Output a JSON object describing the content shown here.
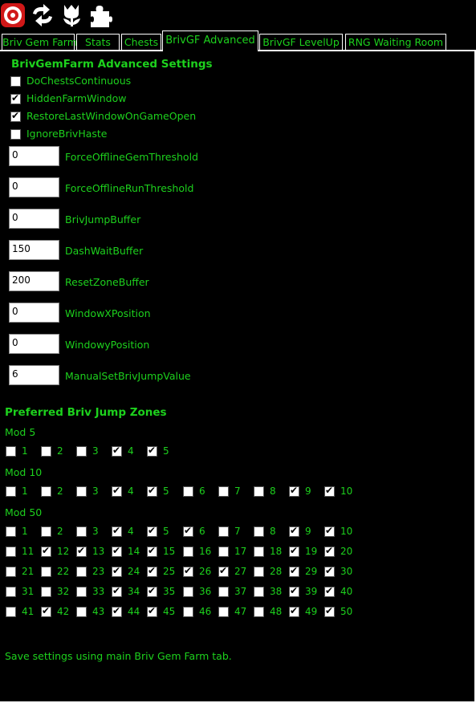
{
  "toolbar": {
    "icons": [
      "record-icon",
      "refresh-icon",
      "tulip-icon",
      "puzzle-icon"
    ]
  },
  "tabs": [
    {
      "label": "Briv Gem Farm",
      "active": false
    },
    {
      "label": "Stats",
      "active": false
    },
    {
      "label": "Chests",
      "active": false
    },
    {
      "label": "BrivGF Advanced",
      "active": true
    },
    {
      "label": "BrivGF LevelUp",
      "active": false
    },
    {
      "label": "RNG Waiting Room",
      "active": false
    }
  ],
  "advanced": {
    "title": "BrivGemFarm Advanced Settings",
    "checkboxes": [
      {
        "label": "DoChestsContinuous",
        "checked": false
      },
      {
        "label": "HiddenFarmWindow",
        "checked": true
      },
      {
        "label": "RestoreLastWindowOnGameOpen",
        "checked": true
      },
      {
        "label": "IgnoreBrivHaste",
        "checked": false
      }
    ],
    "fields": [
      {
        "label": "ForceOfflineGemThreshold",
        "value": "0"
      },
      {
        "label": "ForceOfflineRunThreshold",
        "value": "0"
      },
      {
        "label": "BrivJumpBuffer",
        "value": "0"
      },
      {
        "label": "DashWaitBuffer",
        "value": "150"
      },
      {
        "label": "ResetZoneBuffer",
        "value": "200"
      },
      {
        "label": "WindowXPosition",
        "value": "0"
      },
      {
        "label": "WindowyPosition",
        "value": "0"
      },
      {
        "label": "ManualSetBrivJumpValue",
        "value": "6"
      }
    ]
  },
  "jump_zones": {
    "title": "Preferred Briv Jump Zones",
    "mods": [
      {
        "label": "Mod 5",
        "zones": [
          {
            "n": "1",
            "checked": false
          },
          {
            "n": "2",
            "checked": false
          },
          {
            "n": "3",
            "checked": false
          },
          {
            "n": "4",
            "checked": true
          },
          {
            "n": "5",
            "checked": true
          }
        ]
      },
      {
        "label": "Mod 10",
        "zones": [
          {
            "n": "1",
            "checked": false
          },
          {
            "n": "2",
            "checked": false
          },
          {
            "n": "3",
            "checked": false
          },
          {
            "n": "4",
            "checked": true
          },
          {
            "n": "5",
            "checked": true
          },
          {
            "n": "6",
            "checked": false
          },
          {
            "n": "7",
            "checked": false
          },
          {
            "n": "8",
            "checked": false
          },
          {
            "n": "9",
            "checked": true
          },
          {
            "n": "10",
            "checked": true
          }
        ]
      },
      {
        "label": "Mod 50",
        "zones": [
          {
            "n": "1",
            "checked": false
          },
          {
            "n": "2",
            "checked": false
          },
          {
            "n": "3",
            "checked": false
          },
          {
            "n": "4",
            "checked": true
          },
          {
            "n": "5",
            "checked": true
          },
          {
            "n": "6",
            "checked": true
          },
          {
            "n": "7",
            "checked": false
          },
          {
            "n": "8",
            "checked": false
          },
          {
            "n": "9",
            "checked": true
          },
          {
            "n": "10",
            "checked": true
          },
          {
            "n": "11",
            "checked": false
          },
          {
            "n": "12",
            "checked": true
          },
          {
            "n": "13",
            "checked": true
          },
          {
            "n": "14",
            "checked": true
          },
          {
            "n": "15",
            "checked": true
          },
          {
            "n": "16",
            "checked": false
          },
          {
            "n": "17",
            "checked": false
          },
          {
            "n": "18",
            "checked": false
          },
          {
            "n": "19",
            "checked": true
          },
          {
            "n": "20",
            "checked": true
          },
          {
            "n": "21",
            "checked": false
          },
          {
            "n": "22",
            "checked": false
          },
          {
            "n": "23",
            "checked": false
          },
          {
            "n": "24",
            "checked": true
          },
          {
            "n": "25",
            "checked": true
          },
          {
            "n": "26",
            "checked": true
          },
          {
            "n": "27",
            "checked": true
          },
          {
            "n": "28",
            "checked": false
          },
          {
            "n": "29",
            "checked": true
          },
          {
            "n": "30",
            "checked": true
          },
          {
            "n": "31",
            "checked": false
          },
          {
            "n": "32",
            "checked": false
          },
          {
            "n": "33",
            "checked": false
          },
          {
            "n": "34",
            "checked": true
          },
          {
            "n": "35",
            "checked": true
          },
          {
            "n": "36",
            "checked": false
          },
          {
            "n": "37",
            "checked": false
          },
          {
            "n": "38",
            "checked": false
          },
          {
            "n": "39",
            "checked": true
          },
          {
            "n": "40",
            "checked": true
          },
          {
            "n": "41",
            "checked": false
          },
          {
            "n": "42",
            "checked": true
          },
          {
            "n": "43",
            "checked": false
          },
          {
            "n": "44",
            "checked": true
          },
          {
            "n": "45",
            "checked": true
          },
          {
            "n": "46",
            "checked": false
          },
          {
            "n": "47",
            "checked": false
          },
          {
            "n": "48",
            "checked": false
          },
          {
            "n": "49",
            "checked": true
          },
          {
            "n": "50",
            "checked": true
          }
        ]
      }
    ]
  },
  "footer": {
    "note": "Save settings using main Briv Gem Farm tab."
  },
  "colors": {
    "text": "#1dd11d",
    "background": "#000000",
    "border": "#ffffff"
  }
}
